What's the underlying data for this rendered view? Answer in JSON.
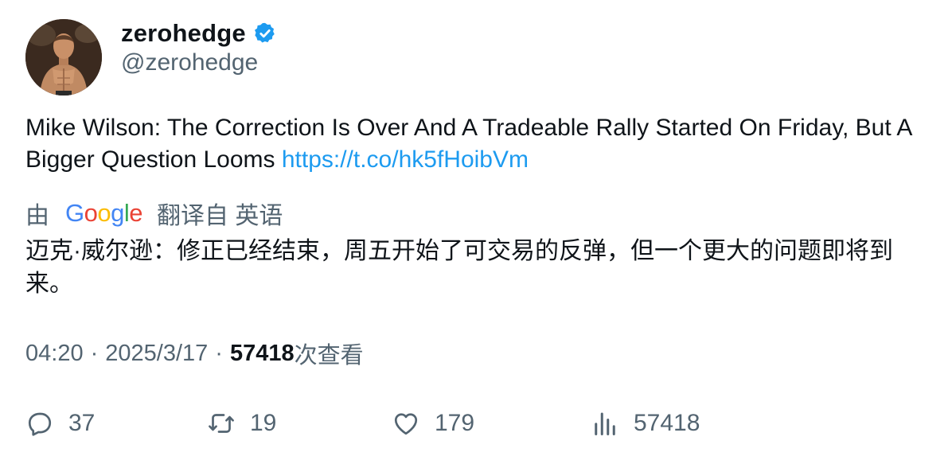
{
  "author": {
    "display_name": "zerohedge",
    "handle": "@zerohedge",
    "verified": true,
    "verified_color": "#1d9bf0"
  },
  "tweet": {
    "text": "Mike Wilson: The Correction Is Over And A Tradeable Rally Started On Friday, But A Bigger Question Looms ",
    "link": "https://t.co/hk5fHoibVm",
    "link_color": "#1d9bf0"
  },
  "translation": {
    "prefix": "由",
    "provider": "Google",
    "suffix": "翻译自 英语",
    "text": "迈克·威尔逊：修正已经结束，周五开始了可交易的反弹，但一个更大的问题即将到来。"
  },
  "meta": {
    "time": "04:20",
    "separator": "·",
    "date": "2025/3/17",
    "views": "57418",
    "views_label": "次查看"
  },
  "actions": {
    "replies": {
      "icon": "reply-icon",
      "count": "37"
    },
    "retweets": {
      "icon": "retweet-icon",
      "count": "19"
    },
    "likes": {
      "icon": "heart-icon",
      "count": "179"
    },
    "views": {
      "icon": "analytics-icon",
      "count": "57418"
    }
  }
}
